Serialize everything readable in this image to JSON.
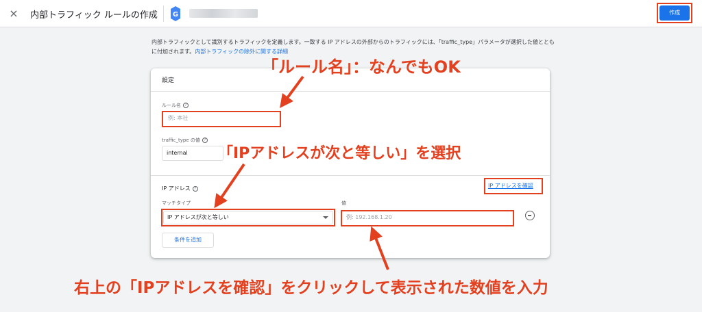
{
  "topbar": {
    "close_icon": "×",
    "title": "内部トラフィック ルールの作成",
    "create_label": "作成"
  },
  "description": {
    "text": "内部トラフィックとして識別するトラフィックを定義します。一致する IP アドレスの外部からのトラフィックには、「traffic_type」パラメータが選択した値とともに付加されます。",
    "link": "内部トラフィックの除外に関する詳細"
  },
  "card": {
    "title": "設定",
    "rule_name": {
      "label": "ルール名",
      "placeholder": "例: 本社"
    },
    "traffic_type": {
      "label": "traffic_type の値",
      "value": "internal"
    },
    "ip": {
      "heading": "IP アドレス",
      "check_link": "IP アドレスを確認",
      "match_label": "マッチタイプ",
      "match_value": "IP アドレスが次と等しい",
      "value_label": "値",
      "value_placeholder": "例: 192.168.1.20",
      "add_condition": "条件を追加"
    }
  },
  "annotations": {
    "rule_name": "「ルール名」：なんでもOK",
    "match_type": "「IPアドレスが次と等しい」を選択",
    "ip_value": "右上の「IPアドレスを確認」をクリックして表示された数値を入力"
  },
  "colors": {
    "accent": "#e3401f",
    "primary": "#1a73e8"
  }
}
